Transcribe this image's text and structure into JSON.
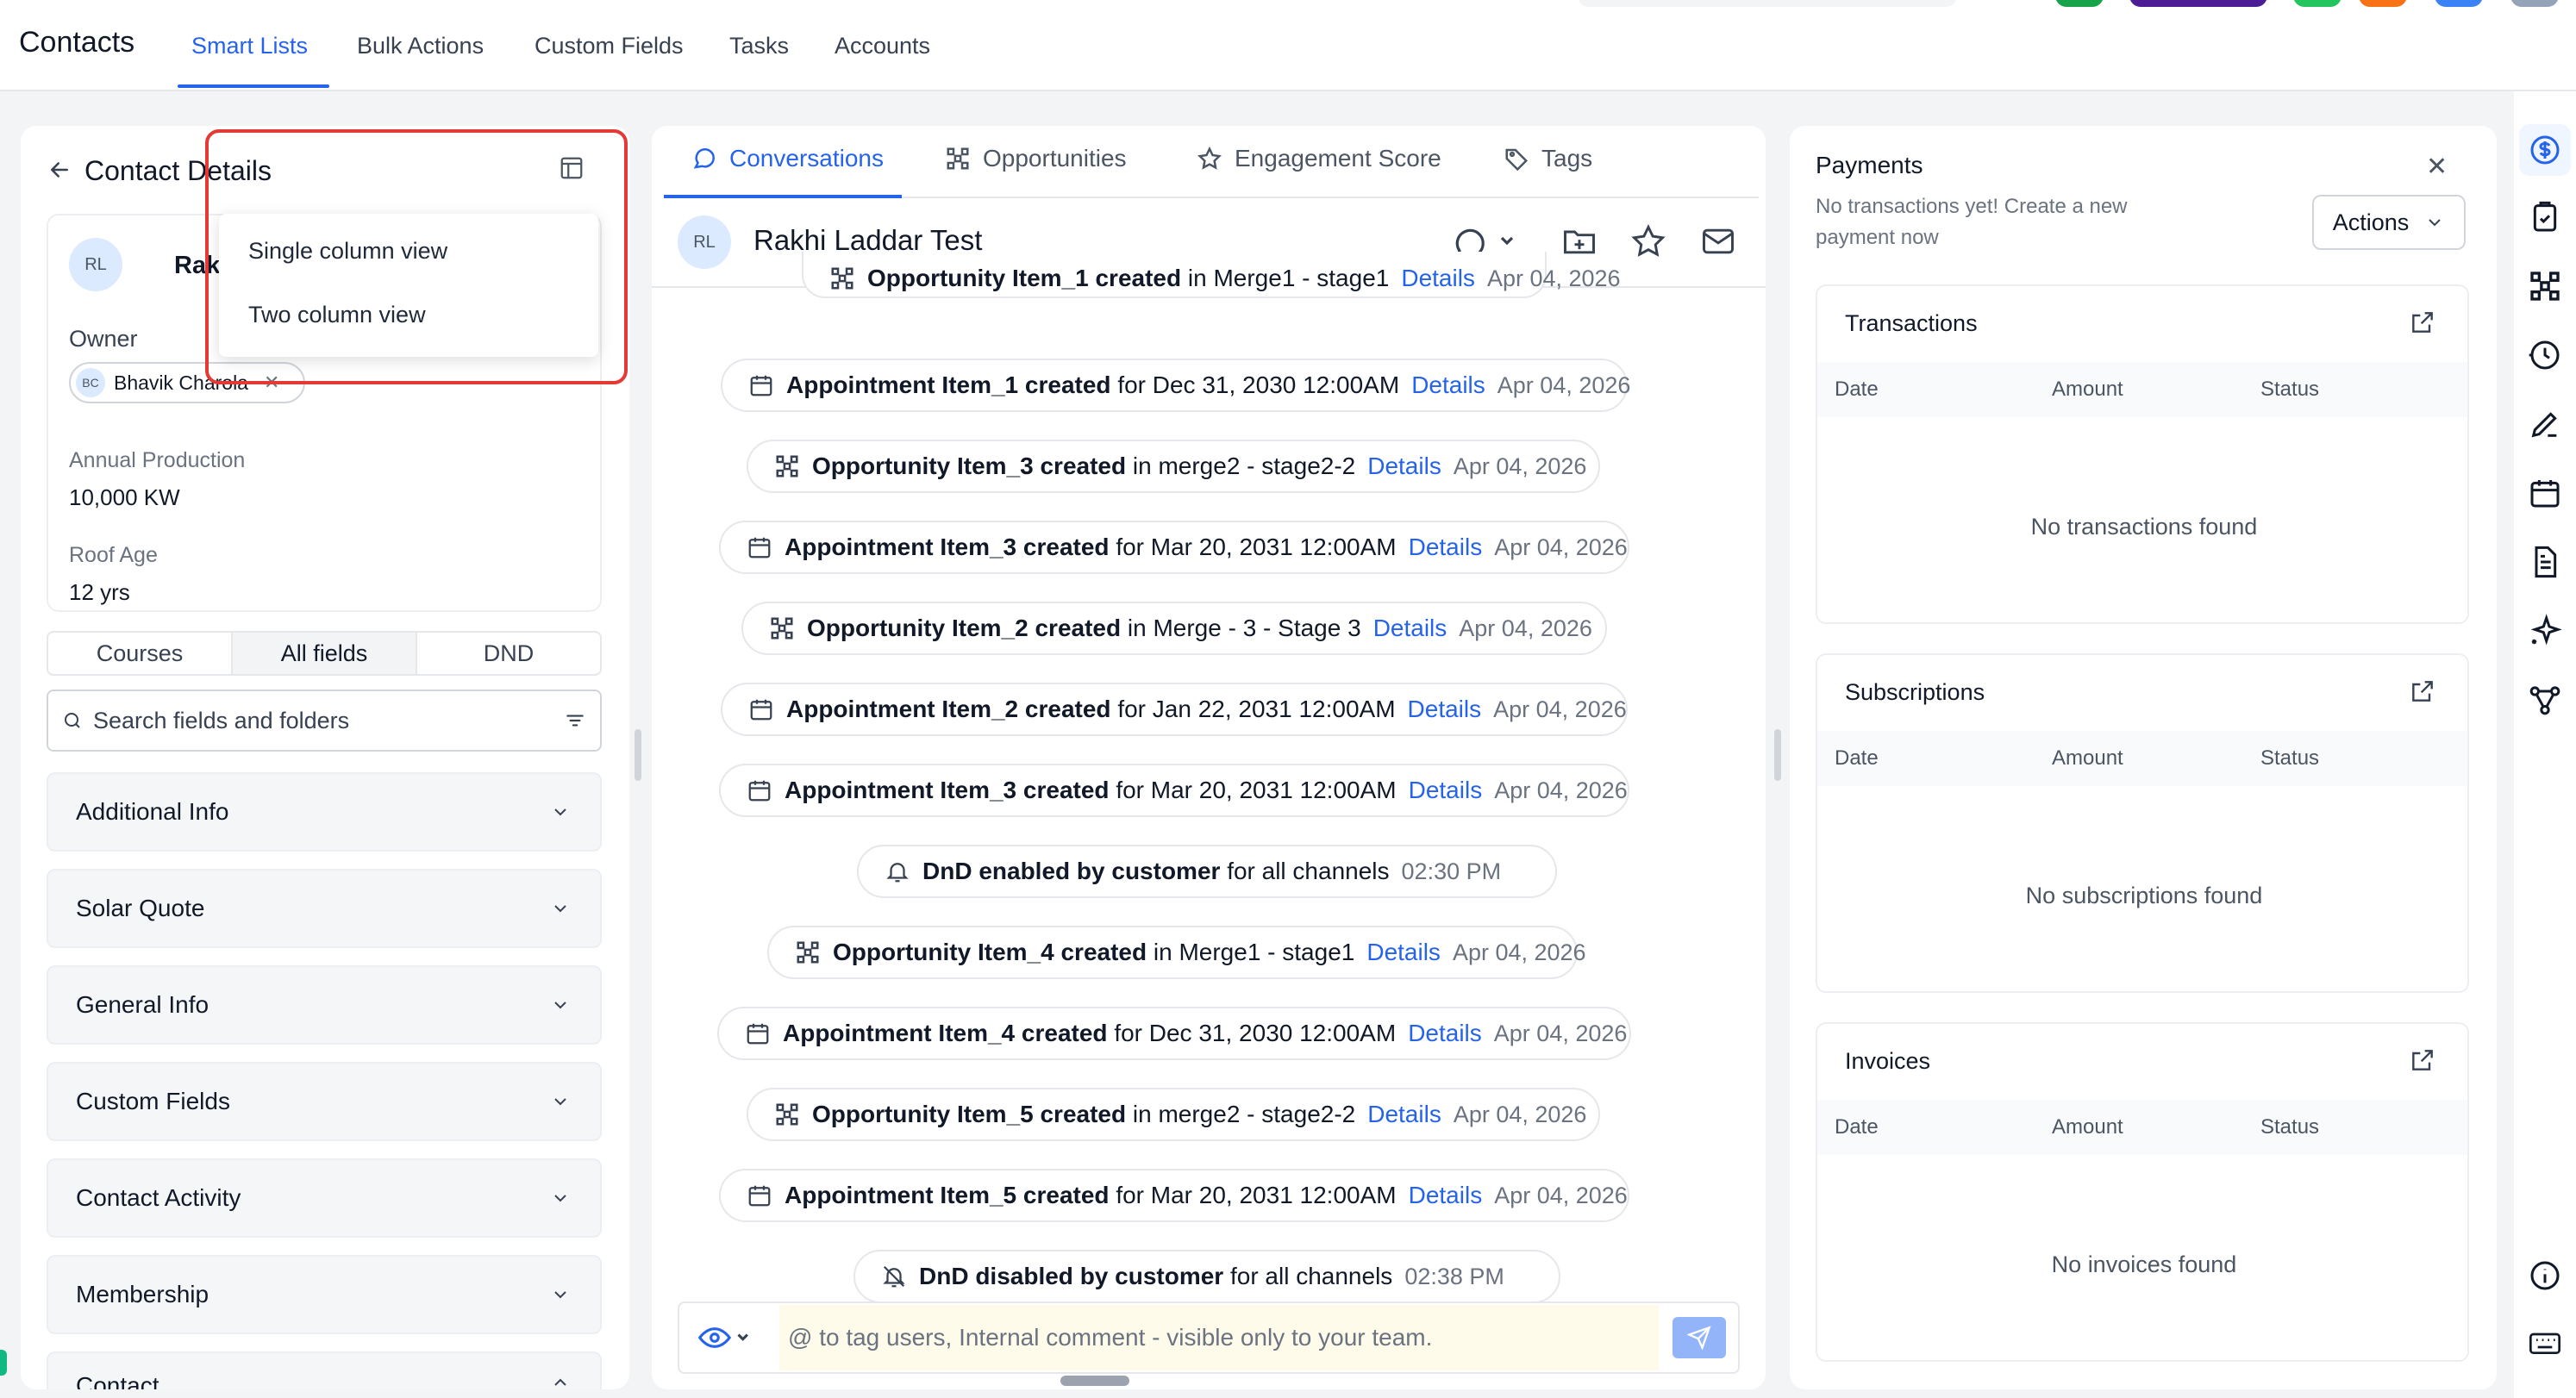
{
  "topnav": {
    "brand": "Contacts",
    "tabs": [
      "Smart Lists",
      "Bulk Actions",
      "Custom Fields",
      "Tasks",
      "Accounts"
    ],
    "active_tab": "Smart Lists"
  },
  "left": {
    "title": "Contact Details",
    "contact": {
      "initials": "RL",
      "name": "Rakhi"
    },
    "owner_label": "Owner",
    "owner": {
      "initials": "BC",
      "name": "Bhavik Charola"
    },
    "fields": [
      {
        "label": "Annual Production",
        "value": "10,000 KW"
      },
      {
        "label": "Roof Age",
        "value": "12 yrs"
      }
    ],
    "segments": [
      "Courses",
      "All fields",
      "DND"
    ],
    "active_segment": "All fields",
    "search_placeholder": "Search fields and folders",
    "sections": [
      "Additional Info",
      "Solar Quote",
      "General Info",
      "Custom Fields",
      "Contact Activity",
      "Membership",
      "Contact"
    ],
    "layout_menu": [
      "Single column view",
      "Two column view"
    ]
  },
  "center": {
    "tabs": [
      "Conversations",
      "Opportunities",
      "Engagement Score",
      "Tags"
    ],
    "active_tab": "Conversations",
    "contact": {
      "initials": "RL",
      "name": "Rakhi Laddar Test"
    },
    "timeline": [
      {
        "kind": "opportunity",
        "bold": "Opportunity Item_1 created",
        "rest": "in Merge1 - stage1",
        "link": "Details",
        "date": "Apr 04, 2026"
      },
      {
        "kind": "appointment",
        "bold": "Appointment Item_1 created",
        "rest": "for Dec 31, 2030 12:00AM",
        "link": "Details",
        "date": "Apr 04, 2026"
      },
      {
        "kind": "opportunity",
        "bold": "Opportunity Item_3 created",
        "rest": "in merge2 - stage2-2",
        "link": "Details",
        "date": "Apr 04, 2026"
      },
      {
        "kind": "appointment",
        "bold": "Appointment Item_3 created",
        "rest": "for Mar 20, 2031 12:00AM",
        "link": "Details",
        "date": "Apr 04, 2026"
      },
      {
        "kind": "opportunity",
        "bold": "Opportunity Item_2 created",
        "rest": "in Merge - 3 - Stage 3",
        "link": "Details",
        "date": "Apr 04, 2026"
      },
      {
        "kind": "appointment",
        "bold": "Appointment Item_2 created",
        "rest": "for Jan 22, 2031 12:00AM",
        "link": "Details",
        "date": "Apr 04, 2026"
      },
      {
        "kind": "appointment",
        "bold": "Appointment Item_3 created",
        "rest": "for Mar 20, 2031 12:00AM",
        "link": "Details",
        "date": "Apr 04, 2026"
      },
      {
        "kind": "bell",
        "bold": "DnD enabled by customer",
        "rest": "for all channels",
        "link": "",
        "date": "02:30 PM"
      },
      {
        "kind": "opportunity",
        "bold": "Opportunity Item_4 created",
        "rest": "in Merge1 - stage1",
        "link": "Details",
        "date": "Apr 04, 2026"
      },
      {
        "kind": "appointment",
        "bold": "Appointment Item_4 created",
        "rest": "for Dec 31, 2030 12:00AM",
        "link": "Details",
        "date": "Apr 04, 2026"
      },
      {
        "kind": "opportunity",
        "bold": "Opportunity Item_5 created",
        "rest": "in merge2 - stage2-2",
        "link": "Details",
        "date": "Apr 04, 2026"
      },
      {
        "kind": "appointment",
        "bold": "Appointment Item_5 created",
        "rest": "for Mar 20, 2031 12:00AM",
        "link": "Details",
        "date": "Apr 04, 2026"
      },
      {
        "kind": "bell-off",
        "bold": "DnD disabled by customer",
        "rest": "for all channels",
        "link": "",
        "date": "02:38 PM"
      }
    ],
    "composer_placeholder": "@ to tag users, Internal comment - visible only to your team."
  },
  "right": {
    "title": "Payments",
    "subtitle": "No transactions yet! Create a new payment now",
    "actions_label": "Actions",
    "columns": [
      "Date",
      "Amount",
      "Status"
    ],
    "cards": [
      {
        "title": "Transactions",
        "empty": "No transactions found"
      },
      {
        "title": "Subscriptions",
        "empty": "No subscriptions found"
      },
      {
        "title": "Invoices",
        "empty": "No invoices found"
      }
    ]
  },
  "colors": {
    "accent": "#2563eb",
    "highlight_box": "#e53935",
    "composer_bg": "#fefbea"
  }
}
